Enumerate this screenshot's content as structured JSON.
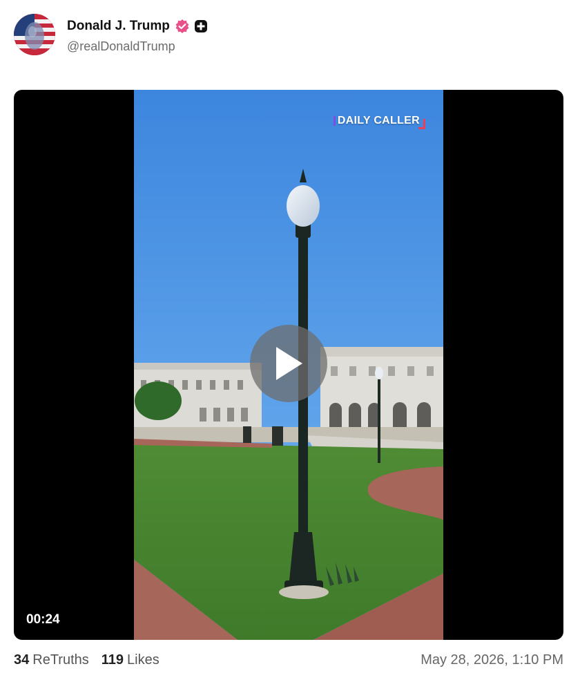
{
  "post": {
    "author": {
      "display_name": "Donald J. Trump",
      "handle": "@realDonaldTrump",
      "verified_color": "#e8508a"
    },
    "video": {
      "watermark": "DAILY CALLER",
      "duration": "00:24"
    },
    "stats": {
      "retruths_count": "34",
      "retruths_label": "ReTruths",
      "likes_count": "119",
      "likes_label": "Likes"
    },
    "timestamp": "May 28, 2026, 1:10 PM"
  }
}
